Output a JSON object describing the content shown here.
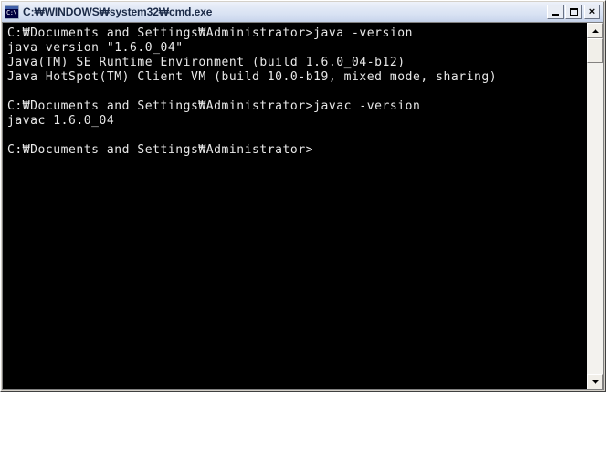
{
  "window": {
    "title": "C:₩WINDOWS₩system32₩cmd.exe",
    "icon_name": "cmd-console-icon",
    "icon_text": "C:\\",
    "colors": {
      "console_background": "#000000",
      "console_text": "#e8e8e8",
      "titlebar_start": "#eef2fa",
      "titlebar_end": "#c3d0e8",
      "frame": "#d4d0c8"
    },
    "controls": {
      "minimize_label": "_",
      "maximize_label": "□",
      "close_label": "×"
    }
  },
  "console": {
    "lines": [
      "C:₩Documents and Settings₩Administrator>java -version",
      "java version \"1.6.0_04\"",
      "Java(TM) SE Runtime Environment (build 1.6.0_04-b12)",
      "Java HotSpot(TM) Client VM (build 10.0-b19, mixed mode, sharing)",
      "",
      "C:₩Documents and Settings₩Administrator>javac -version",
      "javac 1.6.0_04",
      "",
      "C:₩Documents and Settings₩Administrator>"
    ]
  },
  "scrollbar": {
    "up_arrow_name": "scroll-up-arrow",
    "down_arrow_name": "scroll-down-arrow"
  }
}
